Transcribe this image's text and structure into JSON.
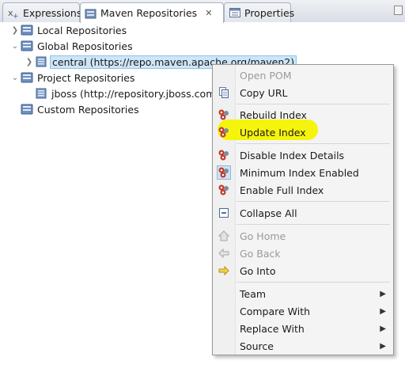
{
  "tabs": [
    {
      "label": "Expressions",
      "icon": "expressions-icon"
    },
    {
      "label": "Maven Repositories",
      "icon": "maven-repositories-icon",
      "close": "✕"
    },
    {
      "label": "Properties",
      "icon": "properties-icon"
    }
  ],
  "tree": {
    "local": "Local Repositories",
    "global": "Global Repositories",
    "central": "central (https://repo.maven.apache.org/maven2)",
    "project": "Project Repositories",
    "jboss": "jboss (http://repository.jboss.com",
    "custom": "Custom Repositories"
  },
  "menu": {
    "open_pom": "Open POM",
    "copy_url": "Copy URL",
    "rebuild_index": "Rebuild Index",
    "update_index": "Update Index",
    "disable_index_details": "Disable Index Details",
    "minimum_index_enabled": "Minimum Index Enabled",
    "enable_full_index": "Enable Full Index",
    "collapse_all": "Collapse All",
    "go_home": "Go Home",
    "go_back": "Go Back",
    "go_into": "Go Into",
    "team": "Team",
    "compare_with": "Compare With",
    "replace_with": "Replace With",
    "source": "Source"
  },
  "colors": {
    "selection": "#cde6f7",
    "highlight": "#f4f300",
    "menu_bg": "#f4f4f4"
  }
}
